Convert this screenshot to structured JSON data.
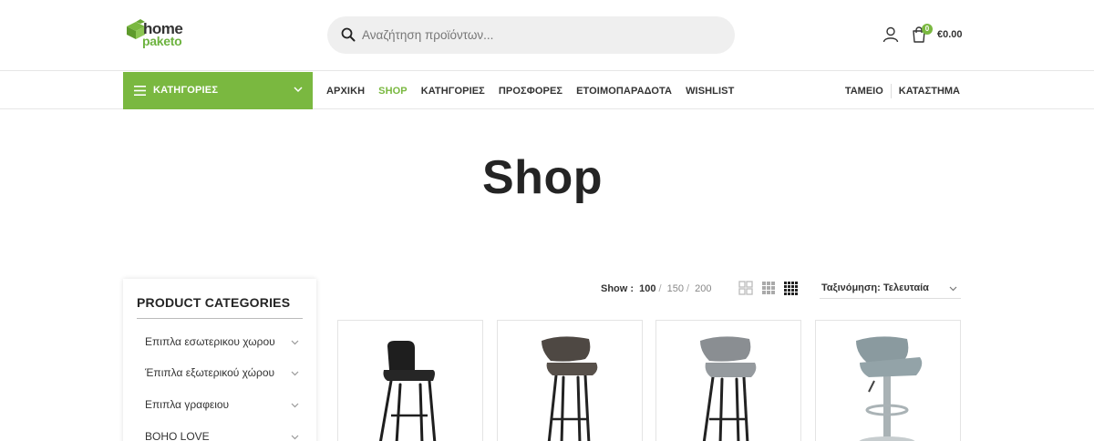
{
  "header": {
    "logo": {
      "line1": "home",
      "line2": "paketo"
    },
    "search": {
      "placeholder": "Αναζήτηση προϊόντων..."
    },
    "cart": {
      "count": "0",
      "total": "€0.00"
    }
  },
  "nav": {
    "categories_label": "ΚΑΤΗΓΟΡΙΕΣ",
    "items": [
      {
        "label": "ΑΡΧΙΚΗ",
        "active": false
      },
      {
        "label": "SHOP",
        "active": true
      },
      {
        "label": "ΚΑΤΗΓΟΡΙΕΣ",
        "active": false
      },
      {
        "label": "ΠΡΟΣΦΟΡΕΣ",
        "active": false
      },
      {
        "label": "ΕΤΟΙΜΟΠΑΡΑΔΟΤΑ",
        "active": false
      },
      {
        "label": "WISHLIST",
        "active": false
      }
    ],
    "right_items": [
      "ΤΑΜΕΙΟ",
      "ΚΑΤΑΣΤΗΜΑ"
    ]
  },
  "page": {
    "title": "Shop"
  },
  "sidebar": {
    "title": "PRODUCT CATEGORIES",
    "items": [
      {
        "label": "Επιπλα εσωτερικου χωρου"
      },
      {
        "label": "Έπιπλα εξωτερικού χώρου"
      },
      {
        "label": "Επιπλα γραφειου"
      },
      {
        "label": "BOHO LOVE"
      }
    ]
  },
  "toolbar": {
    "show_label": "Show :",
    "show_options": [
      "100",
      "150",
      "200"
    ],
    "show_current": "100",
    "sort_label": "Ταξινόμηση: Τελευταία"
  },
  "products": [
    {
      "image": "black-bar-stool",
      "color": "#1e1e1e"
    },
    {
      "image": "brown-bar-stool",
      "color": "#4e4843"
    },
    {
      "image": "grey-bar-stool",
      "color": "#8a8e92"
    },
    {
      "image": "light-grey-gas-lift-stool",
      "color": "#8a9a9f"
    }
  ],
  "colors": {
    "accent": "#7ab840"
  }
}
